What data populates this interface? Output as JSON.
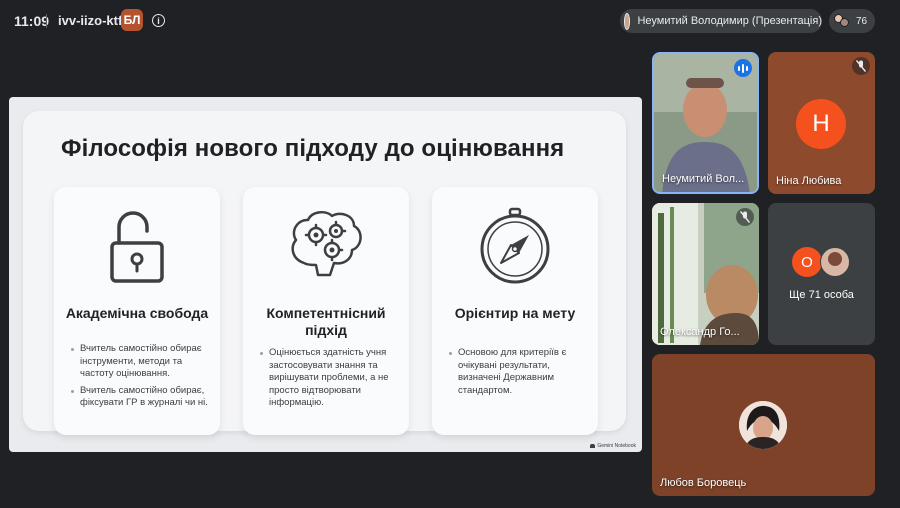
{
  "topbar": {
    "time": "11:09",
    "meeting_code": "ivv-iizo-ktf",
    "badge_text": "БЛ",
    "info_icon": "info-icon",
    "presenter_chip": "Неумитий Володимир (Презентація)",
    "participants_count": "76"
  },
  "slide": {
    "title": "Філософія нового підходу до оцінювання",
    "cards": [
      {
        "icon": "unlocked-padlock-icon",
        "heading": "Академічна свобода",
        "bullets": [
          "Вчитель самостійно обирає інструменти, методи та частоту оцінювання.",
          "Вчитель самостійно обирає, фіксувати ГР в журналі чи ні."
        ]
      },
      {
        "icon": "brain-gears-icon",
        "heading": "Компетентнісний підхід",
        "bullets": [
          "Оцінюється здатність учня застосовувати знання та вирішувати проблеми, а не просто відтворювати інформацію."
        ]
      },
      {
        "icon": "compass-icon",
        "heading": "Орієнтир на мету",
        "bullets": [
          "Основою для критеріїв є очікувані результати, визначені Державним стандартом."
        ]
      }
    ],
    "watermark": "Gemini Notebook"
  },
  "participants": [
    {
      "name": "Неумитий Вол...",
      "status": "speaking"
    },
    {
      "name": "Ніна Любива",
      "initial": "Н",
      "status": "muted"
    },
    {
      "name": "Олександр Го...",
      "status": "muted"
    },
    {
      "name": "Ще 71 особа",
      "initial": "О"
    },
    {
      "name": "Любов Боровець"
    }
  ],
  "colors": {
    "background": "#202124",
    "accent_blue": "#1a73e8",
    "avatar_orange": "#f4511e",
    "tile_brown": "#8e4a2c"
  }
}
